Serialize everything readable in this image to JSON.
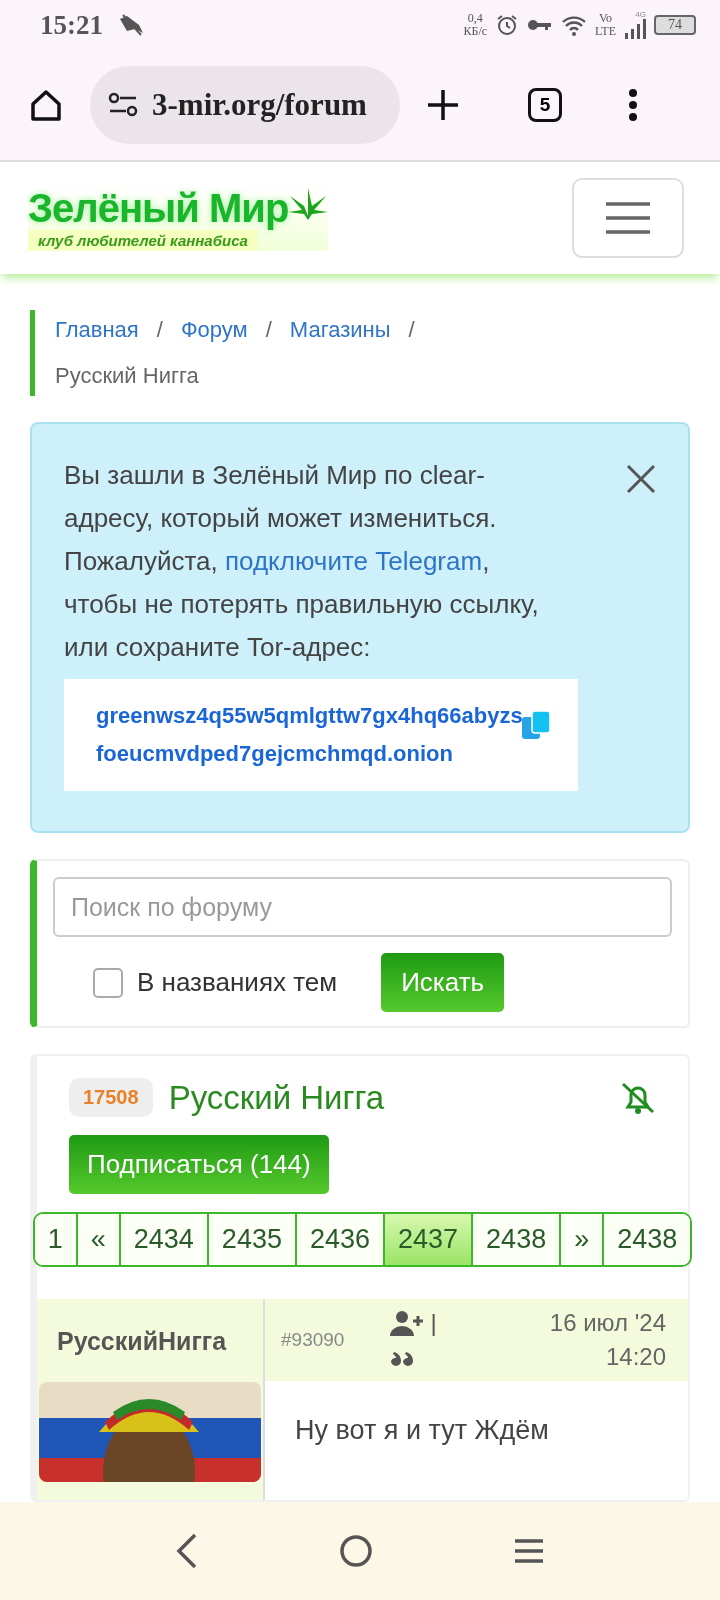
{
  "status_bar": {
    "time": "15:21",
    "net_speed": "0,4\nКБ/с",
    "network": "Vo\nLTE",
    "generation": "4G",
    "battery": "74"
  },
  "browser": {
    "url": "3-mir.org/forum",
    "tab_count": "5"
  },
  "site": {
    "logo_title": "Зелёный Мир",
    "logo_subtitle": "клуб любителей каннабиса"
  },
  "breadcrumbs": [
    {
      "label": "Главная",
      "kind": "link"
    },
    {
      "separator": "/",
      "label": "Форум",
      "kind": "link"
    },
    {
      "separator": "/",
      "label": "Магазины",
      "kind": "link"
    },
    {
      "separator": "/",
      "label": "Русский Нигга",
      "kind": "current"
    }
  ],
  "notice": {
    "text": "Вы зашли в Зелёный Мир по clear-адресу, который может измениться. Пожалуйста, ",
    "link": "подключите Telegram",
    "text_after": ", чтобы не потерять правильную ссылку, или сохраните Tor-адрес:",
    "address": "greenwsz4q55w5qmlgttw7gx4hq66abyzsfoeucmvdped7gejcmchmqd.onion"
  },
  "search": {
    "placeholder": "Поиск по форуму",
    "checkbox_label": "В названиях тем",
    "checked": false,
    "button": "Искать"
  },
  "topic": {
    "id": "17508",
    "title": "Русский Нигга",
    "subscribe": "Подписаться (144)",
    "pages": [
      {
        "label": "1",
        "selected": false
      },
      {
        "label": "«",
        "selected": false
      },
      {
        "label": "2434",
        "selected": false
      },
      {
        "label": "2435",
        "selected": false
      },
      {
        "label": "2436",
        "selected": false
      },
      {
        "label": "2437",
        "selected": true
      },
      {
        "label": "2438",
        "selected": false
      },
      {
        "label": "»",
        "selected": false
      },
      {
        "label": "2438",
        "selected": false
      }
    ]
  },
  "post": {
    "author": "РусскийНигга",
    "number": "#93090",
    "separator": "|",
    "date": "16 июл '24",
    "time": "14:20",
    "text": "Ну вот я и тут Ждём"
  }
}
